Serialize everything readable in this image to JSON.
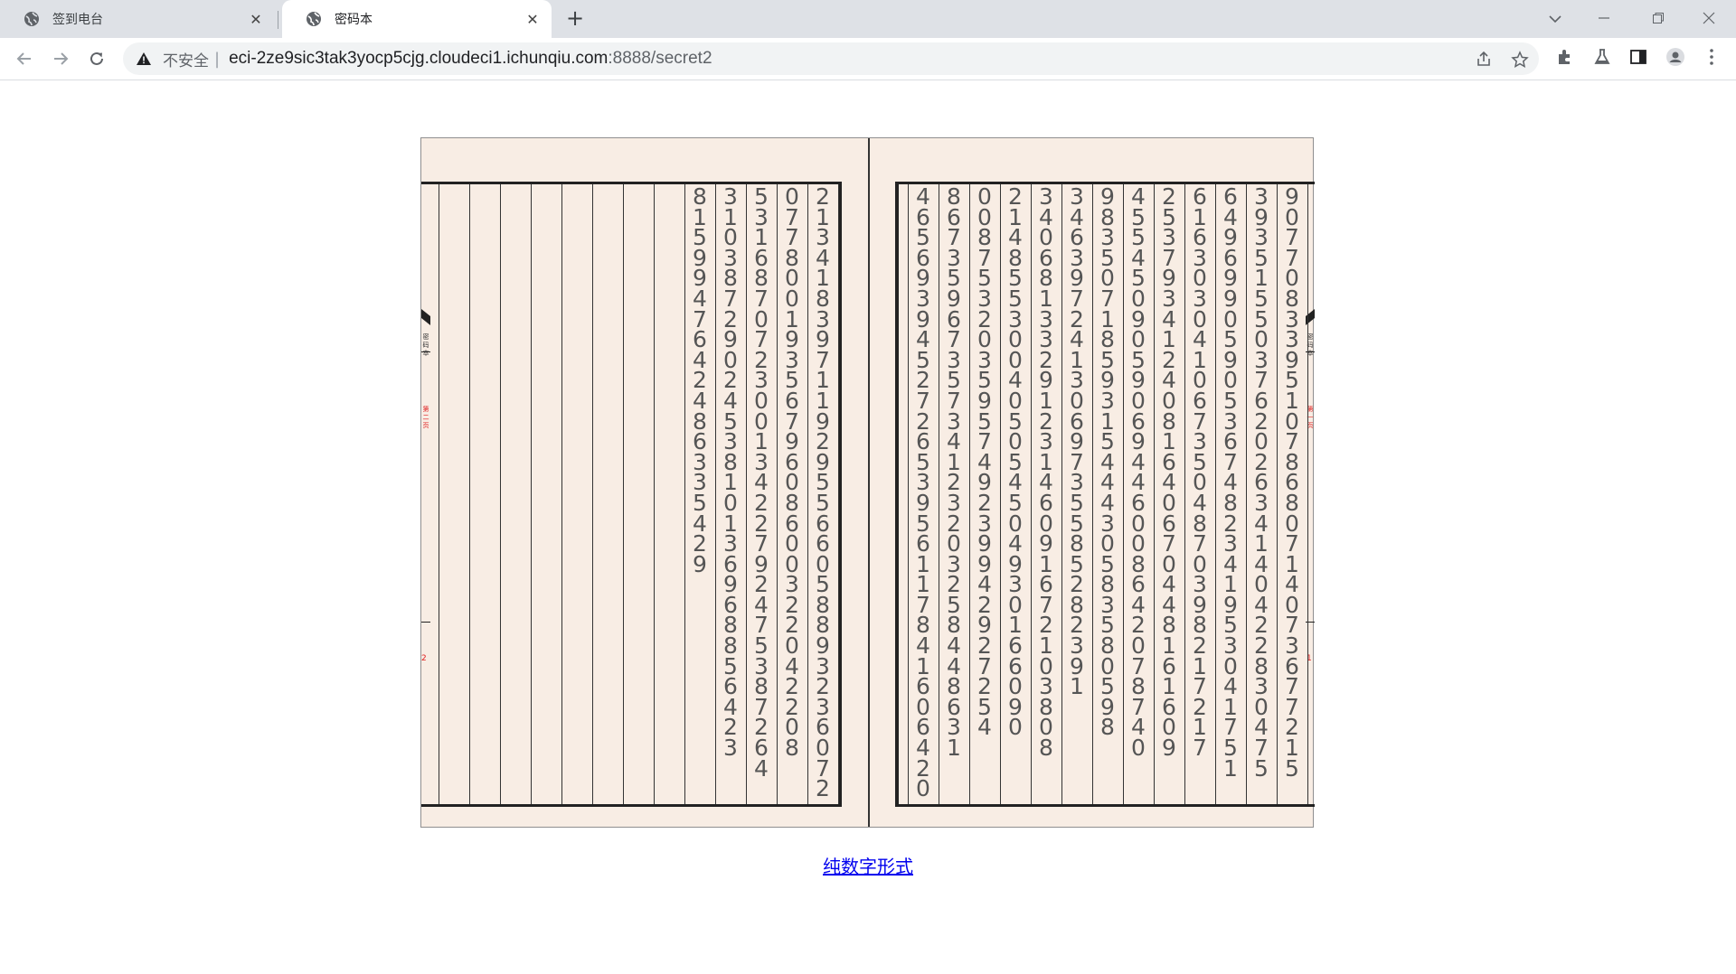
{
  "browser": {
    "tabs": [
      {
        "title": "签到电台",
        "active": false
      },
      {
        "title": "密码本",
        "active": true
      }
    ],
    "address": {
      "security_label": "不安全",
      "separator": "|",
      "host": "eci-2ze9sic3tak3yocp5cjg.cloudeci1.ichunqiu.com",
      "path": ":8888/secret2"
    }
  },
  "book": {
    "left_page_columns": [
      "21341839711929556605889323607 2",
      "07780019356796086003220422 08",
      "53168707230013422792475387264",
      "3103872902453810136968856423",
      "81599476424863354 29"
    ],
    "right_page_columns": [
      "90770833951078680714073677215",
      "39351550376202634140422830475",
      "64969905905367482341953041751",
      "61630304106735048703982172 17",
      "25379341240816406704481616 09",
      "45545090590694460086420787 40",
      "98350718593154443058358059 8",
      "34639724130697355852823 91",
      "34068133291231460916721038 08",
      "21485530040505450493016609 0",
      "00875320359574923994292725 4",
      "86735967357341232032584486 31",
      "46569394527265395611784160642 0"
    ],
    "left_margin_marks": {
      "black": "密码本",
      "red": "第二页",
      "page_number": "2"
    },
    "right_margin_marks": {
      "black": "密码本",
      "red": "第一页",
      "page_number": "1"
    }
  },
  "link_text": "纯数字形式",
  "colors": {
    "page_bg": "#f8ede4",
    "link": "#0000ee",
    "accent_red": "#e02020"
  }
}
